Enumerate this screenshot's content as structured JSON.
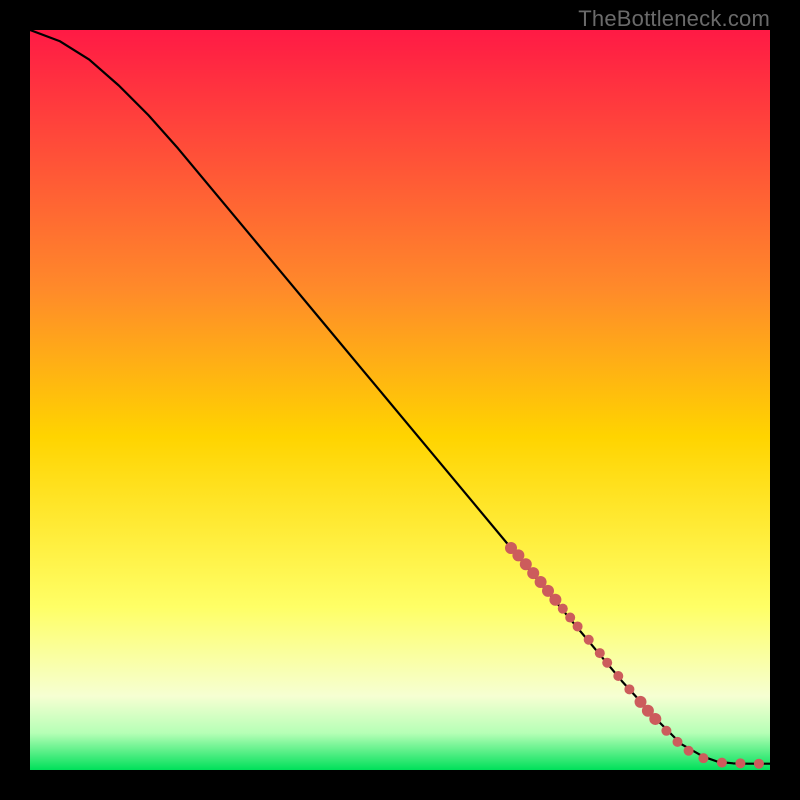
{
  "watermark": "TheBottleneck.com",
  "colors": {
    "background": "#000000",
    "gradient_top": "#ff1a45",
    "gradient_upper_mid": "#ff8a2a",
    "gradient_mid": "#ffd400",
    "gradient_lower_mid": "#ffff66",
    "gradient_lower": "#f6ffd2",
    "gradient_green_light": "#b6ffb6",
    "gradient_green": "#00e05a",
    "curve": "#000000",
    "marker": "#cc5c5c"
  },
  "chart_data": {
    "type": "line",
    "title": "",
    "xlabel": "",
    "ylabel": "",
    "xlim": [
      0,
      100
    ],
    "ylim": [
      0,
      100
    ],
    "series": [
      {
        "name": "bottleneck-curve",
        "x": [
          0,
          4,
          8,
          12,
          16,
          20,
          25,
          30,
          35,
          40,
          45,
          50,
          55,
          60,
          65,
          70,
          75,
          80,
          85,
          88,
          91,
          93,
          95,
          97,
          100
        ],
        "y": [
          100,
          98.5,
          96,
          92.5,
          88.5,
          84,
          78,
          72,
          66,
          60,
          54,
          48,
          42,
          36,
          30,
          24,
          18,
          12,
          6.5,
          3.5,
          1.8,
          1.1,
          0.9,
          0.85,
          0.85
        ]
      }
    ],
    "markers": [
      {
        "x": 65,
        "y": 30,
        "r": 1.2
      },
      {
        "x": 66,
        "y": 29,
        "r": 1.2
      },
      {
        "x": 67,
        "y": 27.8,
        "r": 1.2
      },
      {
        "x": 68,
        "y": 26.6,
        "r": 1.2
      },
      {
        "x": 69,
        "y": 25.4,
        "r": 1.2
      },
      {
        "x": 70,
        "y": 24.2,
        "r": 1.2
      },
      {
        "x": 71,
        "y": 23.0,
        "r": 1.2
      },
      {
        "x": 72,
        "y": 21.8,
        "r": 1.0
      },
      {
        "x": 73,
        "y": 20.6,
        "r": 1.0
      },
      {
        "x": 74,
        "y": 19.4,
        "r": 1.0
      },
      {
        "x": 75.5,
        "y": 17.6,
        "r": 1.0
      },
      {
        "x": 77,
        "y": 15.8,
        "r": 1.0
      },
      {
        "x": 78,
        "y": 14.5,
        "r": 1.0
      },
      {
        "x": 79.5,
        "y": 12.7,
        "r": 1.0
      },
      {
        "x": 81,
        "y": 10.9,
        "r": 1.0
      },
      {
        "x": 82.5,
        "y": 9.2,
        "r": 1.2
      },
      {
        "x": 83.5,
        "y": 8.0,
        "r": 1.2
      },
      {
        "x": 84.5,
        "y": 6.9,
        "r": 1.2
      },
      {
        "x": 86,
        "y": 5.3,
        "r": 1.0
      },
      {
        "x": 87.5,
        "y": 3.8,
        "r": 1.0
      },
      {
        "x": 89,
        "y": 2.6,
        "r": 1.0
      },
      {
        "x": 91,
        "y": 1.6,
        "r": 1.0
      },
      {
        "x": 93.5,
        "y": 1.0,
        "r": 1.0
      },
      {
        "x": 96,
        "y": 0.9,
        "r": 1.0
      },
      {
        "x": 98.5,
        "y": 0.85,
        "r": 1.0
      }
    ]
  }
}
